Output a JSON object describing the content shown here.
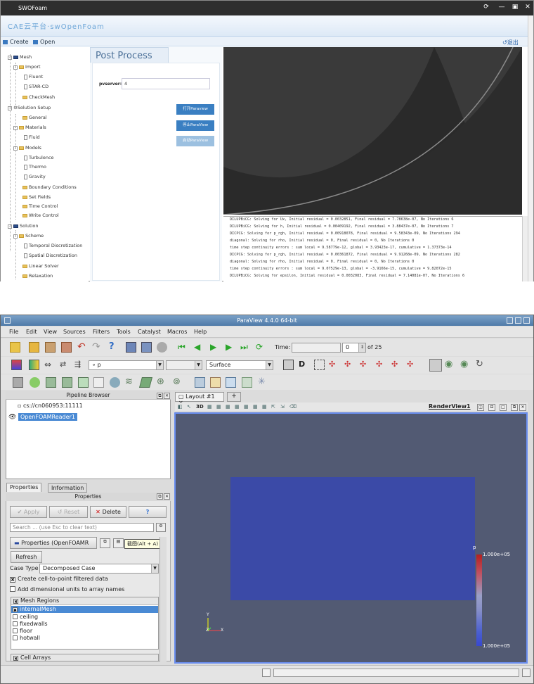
{
  "top_app": {
    "window_title": "SWOFoam",
    "window_controls": [
      "⟳",
      "—",
      "▣",
      "✕"
    ],
    "brand": "CAE云平台·swOpenFoam",
    "toolbar": {
      "create": "Create",
      "open": "Open",
      "logout": "退出"
    },
    "tree": {
      "mesh": "Mesh",
      "import": "Import",
      "fluent": "Fluent",
      "starcd": "STAR-CD",
      "checkmesh": "CheckMesh",
      "solution_setup": "Solution Setup",
      "general": "General",
      "materials": "Materials",
      "fluid": "Fluid",
      "models": "Models",
      "turbulence": "Turbulence",
      "thermo": "Thermo",
      "gravity": "Gravity",
      "boundary_conditions": "Boundary Conditions",
      "set_fields": "Set Fields",
      "time_control": "Time Control",
      "write_control": "Write Control",
      "solution": "Solution",
      "scheme": "Scheme",
      "temporal": "Temporal Discretization",
      "spatial": "Spatial Discretization",
      "linear_solver": "Linear Solver",
      "relaxation": "Relaxation"
    },
    "post": {
      "title": "Post Process",
      "pvserver_label": "pvserver:",
      "pvserver_value": "4",
      "btn_open": "打开Paraview",
      "btn_pause": "停止ParaView",
      "btn_restart": "启动ParaView"
    },
    "log_lines": [
      "DILUPBiCG:  Solving for Ux, Initial residual = 0.0032851, Final residual = 7.78638e-07, No Iterations 6",
      "DILUPBiCG:  Solving for h, Initial residual = 0.00409192, Final residual = 3.88437e-07, No Iterations 7",
      "DICPCG:  Solving for p_rgh, Initial residual = 0.00918078, Final residual = 9.58343e-09, No Iterations 294",
      "diagonal:  Solving for rho, Initial residual = 0, Final residual = 0, No Iterations 0",
      "time step continuity errors : sum local = 9.58779e-12, global = 3.93423e-17, cumulative = 1.37373e-14",
      "DICPCG:  Solving for p_rgh, Initial residual = 0.00361872, Final residual = 9.91268e-09, No Iterations 282",
      "diagonal:  Solving for rho, Initial residual = 0, Final residual = 0, No Iterations 0",
      "time step continuity errors : sum local = 9.07529e-13, global = -3.9166e-15, cumulative = 9.82072e-15",
      "DILUPBiCG:  Solving for epsilon, Initial residual = 0.0032083, Final residual = 7.14081e-07, No Iterations 6"
    ]
  },
  "paraview": {
    "window_title": "ParaView 4.4.0 64-bit",
    "menus": [
      "File",
      "Edit",
      "View",
      "Sources",
      "Filters",
      "Tools",
      "Catalyst",
      "Macros",
      "Help"
    ],
    "time_label": "Time:",
    "time_value": "0",
    "time_of": "of 25",
    "color_combo": "p",
    "representation": "Surface",
    "pipeline_header": "Pipeline Browser",
    "server": "cs://cn060953:11111",
    "reader": "OpenFOAMReader1",
    "tabs": {
      "properties": "Properties",
      "information": "Information"
    },
    "properties_header": "Properties",
    "btn_apply": "Apply",
    "btn_reset": "Reset",
    "btn_delete": "Delete",
    "btn_help": "?",
    "search_placeholder": "Search ... (use Esc to clear text)",
    "section_label": "Properties (OpenFOAMR",
    "tooltip": "截图(Alt + A)",
    "btn_refresh": "Refresh",
    "case_type_label": "Case Type",
    "case_type_value": "Decomposed Case",
    "opt_create_cell": "Create cell-to-point filtered data",
    "opt_dim_units": "Add dimensional units to array names",
    "regions_header": "Mesh Regions",
    "regions": [
      "internalMesh",
      "ceiling",
      "fixedwalls",
      "floor",
      "hotwall"
    ],
    "cell_arrays": "Cell Arrays",
    "layout_tab": "Layout #1",
    "add_tab": "+",
    "view_name": "RenderView1",
    "view_toolbar_3d": "3D",
    "colorbar": {
      "title": "p",
      "max": "1.000e+05",
      "min": "1.000e+05"
    },
    "axes": {
      "x": "X",
      "y": "Y",
      "z": "Z"
    }
  }
}
